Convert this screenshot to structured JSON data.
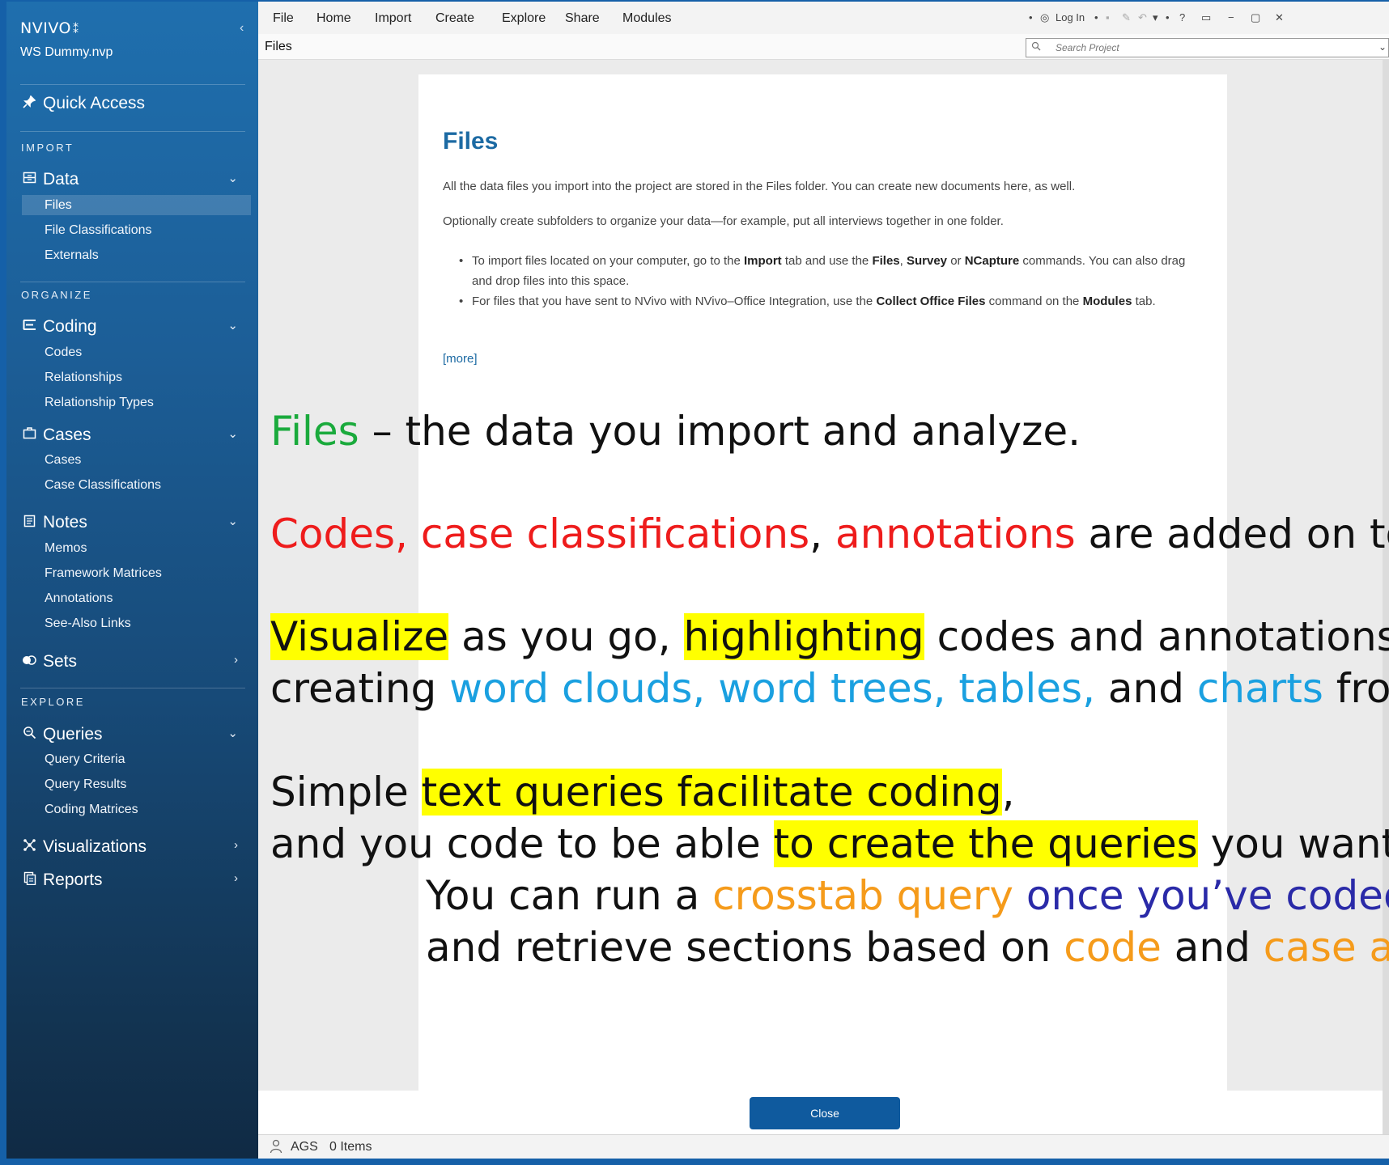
{
  "app": {
    "brand": "NVIVO",
    "brand_mark": "⁑",
    "project_file": "WS Dummy.nvp",
    "collapse": "‹"
  },
  "sidebar": {
    "quick_access": "Quick Access",
    "sections": {
      "import": "IMPORT",
      "organize": "ORGANIZE",
      "explore": "EXPLORE"
    },
    "groups": {
      "data": {
        "label": "Data",
        "icon": "data-icon",
        "items": [
          "Files",
          "File Classifications",
          "Externals"
        ]
      },
      "coding": {
        "label": "Coding",
        "icon": "coding-icon",
        "items": [
          "Codes",
          "Relationships",
          "Relationship Types"
        ]
      },
      "cases": {
        "label": "Cases",
        "icon": "cases-icon",
        "items": [
          "Cases",
          "Case Classifications"
        ]
      },
      "notes": {
        "label": "Notes",
        "icon": "notes-icon",
        "items": [
          "Memos",
          "Framework Matrices",
          "Annotations",
          "See-Also Links"
        ]
      },
      "sets": {
        "label": "Sets",
        "icon": "sets-icon"
      },
      "queries": {
        "label": "Queries",
        "icon": "queries-icon",
        "items": [
          "Query Criteria",
          "Query Results",
          "Coding Matrices"
        ]
      },
      "visualizations": {
        "label": "Visualizations",
        "icon": "visualizations-icon"
      },
      "reports": {
        "label": "Reports",
        "icon": "reports-icon"
      }
    },
    "active_item": "Files"
  },
  "menubar": {
    "items": [
      "File",
      "Home",
      "Import",
      "Create",
      "Explore",
      "Share",
      "Modules"
    ],
    "login": "Log In",
    "help": "?"
  },
  "pathbar": {
    "title": "Files",
    "search_placeholder": "Search Project"
  },
  "card": {
    "title": "Files",
    "p1": "All the data files you import into the project are stored in the Files folder. You can create new documents here, as well.",
    "p2": "Optionally create subfolders to organize your data—for example, put all interviews together in one folder.",
    "b1": {
      "t1": "To import files located on your computer, go to the ",
      "s1": "Import",
      "t2": " tab and use the ",
      "s2": "Files",
      "t3": ", ",
      "s3": "Survey",
      "t4": " or ",
      "s4": "NCapture",
      "t5": " commands. You can also drag and drop files into this space."
    },
    "b2": {
      "t1": "For files that you have sent to NVivo with NVivo–Office Integration, use the ",
      "s1": "Collect Office Files",
      "t2": " command on the ",
      "s2": "Modules",
      "t3": " tab."
    },
    "more": "[more]",
    "close": "Close"
  },
  "status": {
    "user": "AGS",
    "items": "0 Items"
  },
  "overlay": {
    "l1": {
      "a": "Files",
      "b": " – the data you import and analyze."
    },
    "l2": {
      "a": "Codes, case classifications",
      "b": ", ",
      "c": "annotations",
      "d": " are added on to"
    },
    "l3": {
      "a": "Visualize",
      "b": " as you go, ",
      "c": "highlighting",
      "d": " codes and annotations, "
    },
    "l4": {
      "a": "creating ",
      "b": "word clouds, word trees, tables,",
      "c": " and ",
      "d": "charts",
      "e": " fro"
    },
    "l5": {
      "a": "Simple ",
      "b": "text queries facilitate coding",
      "c": ","
    },
    "l6": {
      "a": "and you code to be able ",
      "b": "to create the queries",
      "c": " you want t"
    },
    "l7": {
      "a": "You can run a ",
      "b": "crosstab query",
      "c": " ",
      "d": "once you’ve coded"
    },
    "l8": {
      "a": "and retrieve sections based on ",
      "b": "code",
      "c": " and ",
      "d": "case at"
    }
  },
  "colors": {
    "sidebar_top": "#1f6fae",
    "sidebar_bottom": "#102a44",
    "accent": "#0f5a9e",
    "highlight": "#ffff00",
    "green": "#1aaa3c",
    "red": "#ee1c1c",
    "blue": "#1aa0e0",
    "orange": "#f59b1b",
    "navy": "#2a2aa8"
  }
}
